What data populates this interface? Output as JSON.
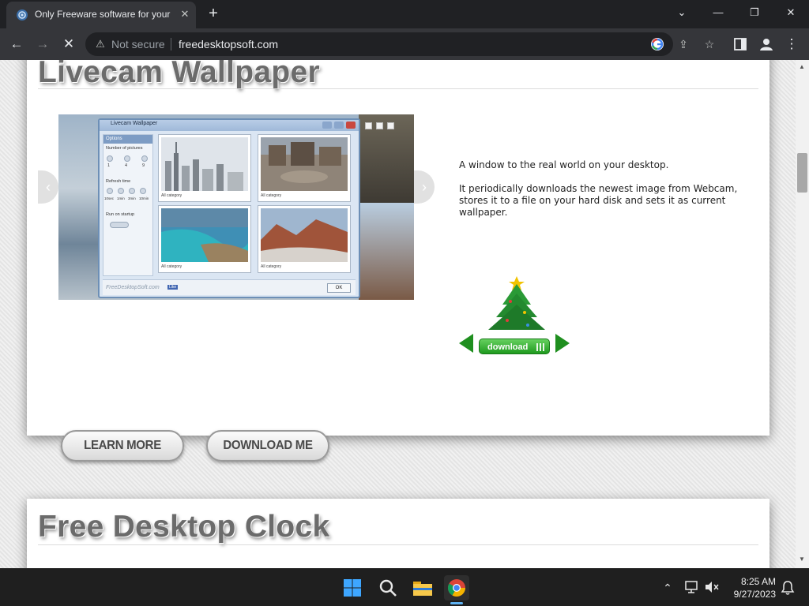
{
  "browser": {
    "tab_title": "Only Freeware software for your",
    "close_tab": "✕",
    "new_tab": "+",
    "window_controls": {
      "chevron": "⌄",
      "minimize": "—",
      "restore": "❐",
      "close": "✕"
    },
    "nav": {
      "back": "←",
      "forward": "→",
      "stop": "✕"
    },
    "security_label": "Not secure",
    "url": "freedesktopsoft.com",
    "icons": [
      "google-icon",
      "share-icon",
      "star-icon",
      "side-panel-icon",
      "profile-icon",
      "menu-icon"
    ]
  },
  "page": {
    "section1": {
      "title": "Livecam Wallpaper",
      "description_1": "A window to the real world on your desktop.",
      "description_2": "It periodically downloads the newest image from Webcam, stores it to a file on your hard disk and sets it as current wallpaper.",
      "download_badge": "download",
      "learn_more": "LEARN MORE",
      "download_me": "DOWNLOAD ME",
      "screenshot": {
        "window_title": "Livecam Wallpaper",
        "options_header": "Options",
        "number_of_pictures": "Number of pictures",
        "refresh_time": "Refresh time",
        "run_on_startup": "Run on startup",
        "pictures_values": [
          "1",
          "4",
          "9"
        ],
        "refresh_values": [
          "10sec",
          "1min",
          "3min",
          "10min"
        ],
        "captions": [
          "All category",
          "All category",
          "All category",
          "All category"
        ],
        "brand": "FreeDesktopSoft.com",
        "like": "Like",
        "ok": "OK"
      }
    },
    "section2": {
      "title": "Free Desktop Clock"
    }
  },
  "taskbar": {
    "time": "8:25 AM",
    "date": "9/27/2023",
    "apps": [
      "windows-start-icon",
      "search-icon",
      "file-explorer-icon",
      "chrome-icon"
    ]
  },
  "colors": {
    "chrome_dark": "#202124",
    "chrome_toolbar": "#35363a",
    "title_gray": "#6b6b6b",
    "download_green": "#1f9a1f",
    "taskbar": "#1f1f1f"
  }
}
